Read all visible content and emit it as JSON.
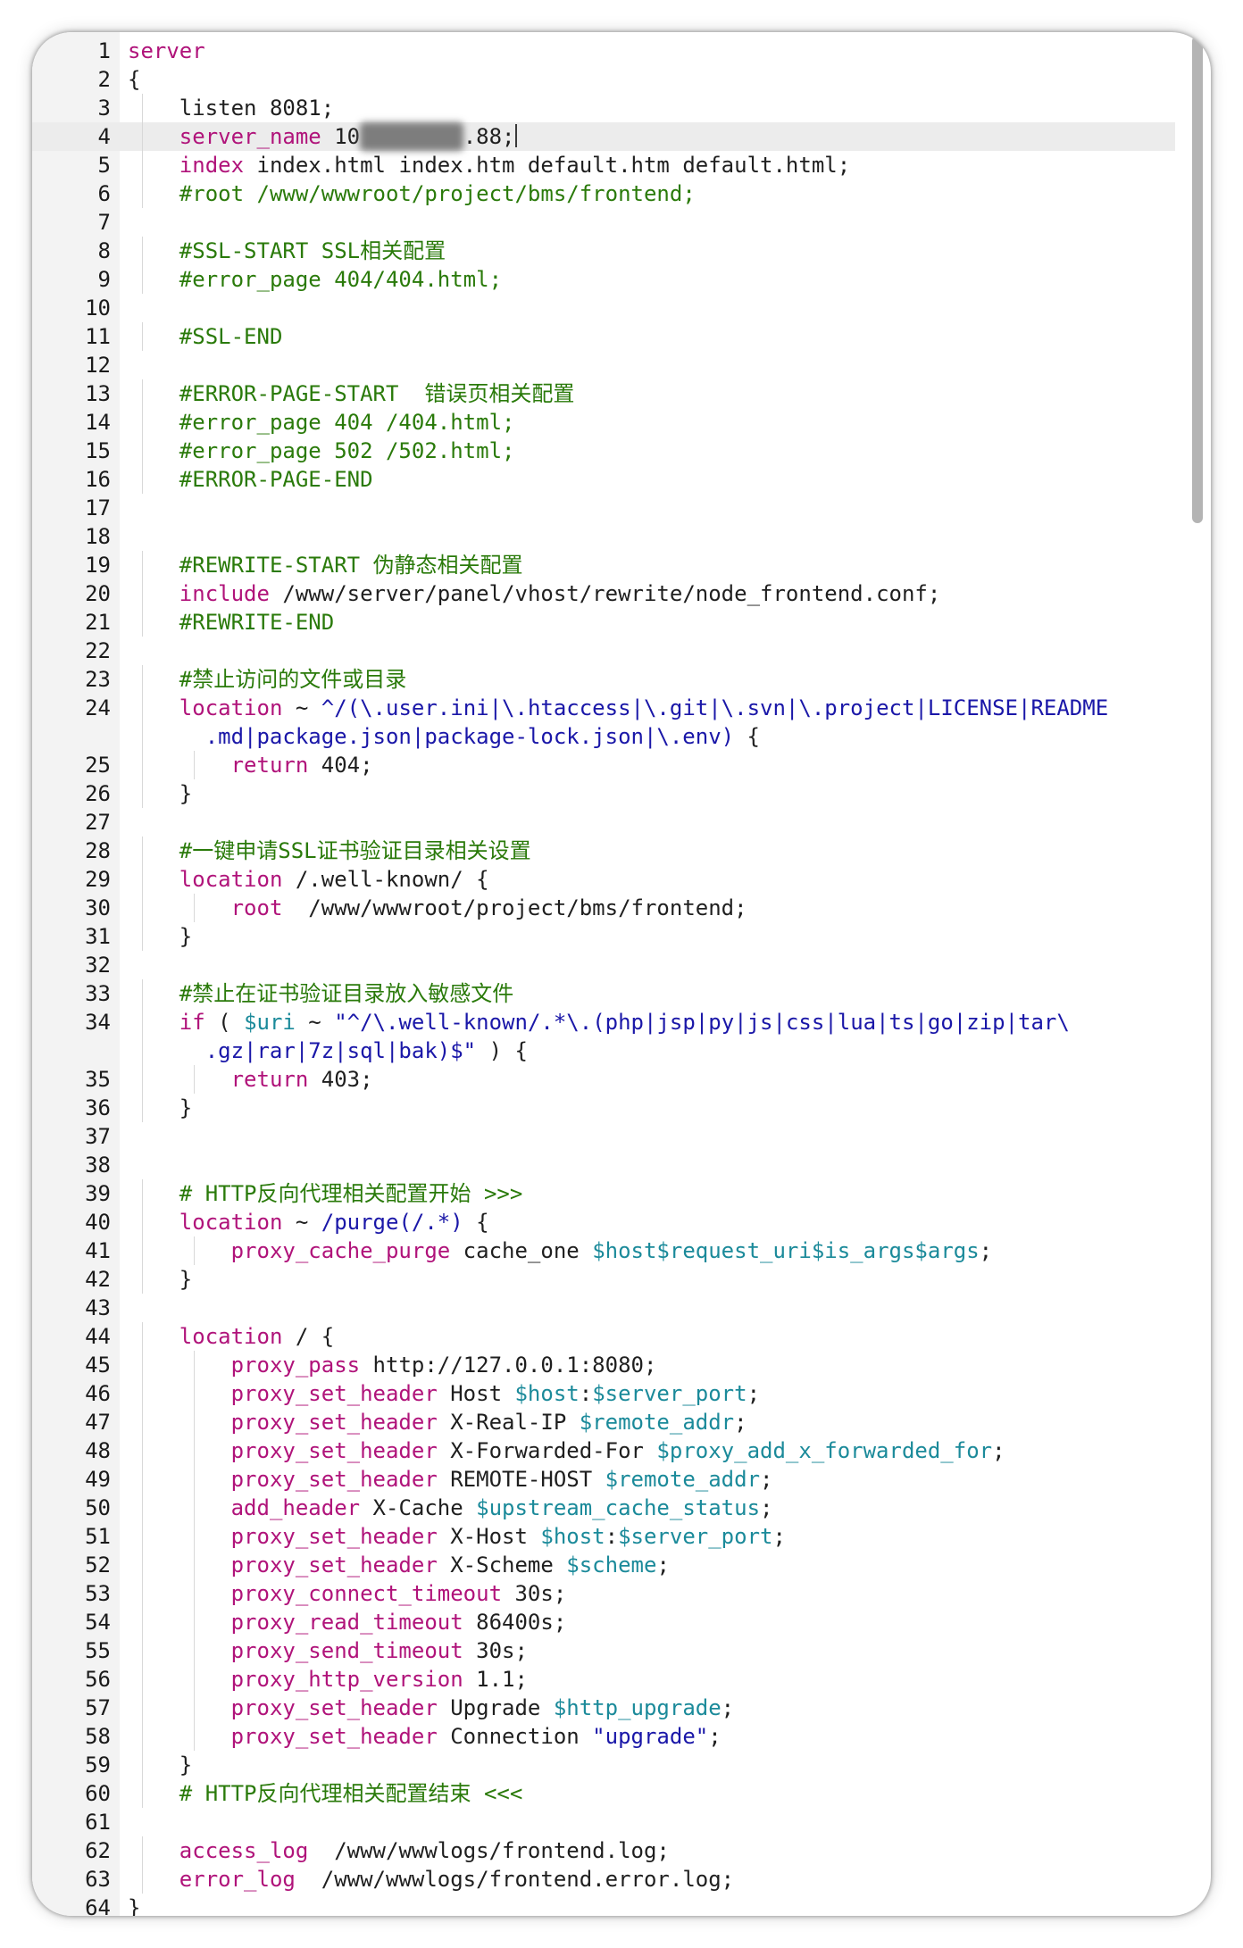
{
  "editor": {
    "active_line": 4,
    "lines": [
      {
        "n": "1",
        "indent": 0,
        "segs": [
          [
            "kw",
            "server"
          ]
        ]
      },
      {
        "n": "2",
        "indent": 0,
        "segs": [
          [
            "t",
            "{"
          ]
        ]
      },
      {
        "n": "3",
        "indent": 1,
        "segs": [
          [
            "t",
            "listen 8081;"
          ]
        ]
      },
      {
        "n": "4",
        "indent": 1,
        "segs": [
          [
            "kw",
            "server_name"
          ],
          [
            "t",
            " 10"
          ],
          [
            "blur",
            "6.1x.113"
          ],
          [
            "t",
            ".88;"
          ],
          [
            "caret",
            ""
          ]
        ]
      },
      {
        "n": "5",
        "indent": 1,
        "segs": [
          [
            "kw",
            "index"
          ],
          [
            "t",
            " index.html index.htm default.htm default.html;"
          ]
        ]
      },
      {
        "n": "6",
        "indent": 1,
        "segs": [
          [
            "cm",
            "#root /www/wwwroot/project/bms/frontend;"
          ]
        ]
      },
      {
        "n": "7",
        "indent": 0,
        "segs": []
      },
      {
        "n": "8",
        "indent": 1,
        "segs": [
          [
            "cm",
            "#SSL-START SSL相关配置"
          ]
        ]
      },
      {
        "n": "9",
        "indent": 1,
        "segs": [
          [
            "cm",
            "#error_page 404/404.html;"
          ]
        ]
      },
      {
        "n": "10",
        "indent": 0,
        "segs": []
      },
      {
        "n": "11",
        "indent": 1,
        "segs": [
          [
            "cm",
            "#SSL-END"
          ]
        ]
      },
      {
        "n": "12",
        "indent": 0,
        "segs": []
      },
      {
        "n": "13",
        "indent": 1,
        "segs": [
          [
            "cm",
            "#ERROR-PAGE-START  错误页相关配置"
          ]
        ]
      },
      {
        "n": "14",
        "indent": 1,
        "segs": [
          [
            "cm",
            "#error_page 404 /404.html;"
          ]
        ]
      },
      {
        "n": "15",
        "indent": 1,
        "segs": [
          [
            "cm",
            "#error_page 502 /502.html;"
          ]
        ]
      },
      {
        "n": "16",
        "indent": 1,
        "segs": [
          [
            "cm",
            "#ERROR-PAGE-END"
          ]
        ]
      },
      {
        "n": "17",
        "indent": 0,
        "segs": []
      },
      {
        "n": "18",
        "indent": 0,
        "segs": []
      },
      {
        "n": "19",
        "indent": 1,
        "segs": [
          [
            "cm",
            "#REWRITE-START 伪静态相关配置"
          ]
        ]
      },
      {
        "n": "20",
        "indent": 1,
        "segs": [
          [
            "kw",
            "include"
          ],
          [
            "t",
            " /www/server/panel/vhost/rewrite/node_frontend.conf;"
          ]
        ]
      },
      {
        "n": "21",
        "indent": 1,
        "segs": [
          [
            "cm",
            "#REWRITE-END"
          ]
        ]
      },
      {
        "n": "22",
        "indent": 0,
        "segs": []
      },
      {
        "n": "23",
        "indent": 1,
        "segs": [
          [
            "cm",
            "#禁止访问的文件或目录"
          ]
        ]
      },
      {
        "n": "24",
        "indent": 1,
        "segs": [
          [
            "kw",
            "location"
          ],
          [
            "t",
            " ~ "
          ],
          [
            "re",
            "^/(\\.user.ini|\\.htaccess|\\.git|\\.svn|\\.project|LICENSE|README"
          ]
        ],
        "cont": [
          [
            "re",
            ".md|package.json|package-lock.json|\\.env)"
          ],
          [
            "t",
            " {"
          ]
        ]
      },
      {
        "n": "25",
        "indent": 2,
        "segs": [
          [
            "kw",
            "return"
          ],
          [
            "t",
            " 404;"
          ]
        ]
      },
      {
        "n": "26",
        "indent": 1,
        "segs": [
          [
            "t",
            "}"
          ]
        ]
      },
      {
        "n": "27",
        "indent": 0,
        "segs": []
      },
      {
        "n": "28",
        "indent": 1,
        "segs": [
          [
            "cm",
            "#一键申请SSL证书验证目录相关设置"
          ]
        ]
      },
      {
        "n": "29",
        "indent": 1,
        "segs": [
          [
            "kw",
            "location"
          ],
          [
            "t",
            " /.well-known/ {"
          ]
        ]
      },
      {
        "n": "30",
        "indent": 2,
        "segs": [
          [
            "kw",
            "root"
          ],
          [
            "t",
            "  /www/wwwroot/project/bms/frontend;"
          ]
        ]
      },
      {
        "n": "31",
        "indent": 1,
        "segs": [
          [
            "t",
            "}"
          ]
        ]
      },
      {
        "n": "32",
        "indent": 0,
        "segs": []
      },
      {
        "n": "33",
        "indent": 1,
        "segs": [
          [
            "cm",
            "#禁止在证书验证目录放入敏感文件"
          ]
        ]
      },
      {
        "n": "34",
        "indent": 1,
        "segs": [
          [
            "kw",
            "if"
          ],
          [
            "t",
            " ( "
          ],
          [
            "var",
            "$uri"
          ],
          [
            "t",
            " ~ "
          ],
          [
            "str",
            "\"^/\\.well-known/.*\\.(php|jsp|py|js|css|lua|ts|go|zip|tar\\"
          ]
        ],
        "cont": [
          [
            "str",
            ".gz|rar|7z|sql|bak)$\""
          ],
          [
            "t",
            " ) {"
          ]
        ]
      },
      {
        "n": "35",
        "indent": 2,
        "segs": [
          [
            "kw",
            "return"
          ],
          [
            "t",
            " 403;"
          ]
        ]
      },
      {
        "n": "36",
        "indent": 1,
        "segs": [
          [
            "t",
            "}"
          ]
        ]
      },
      {
        "n": "37",
        "indent": 0,
        "segs": []
      },
      {
        "n": "38",
        "indent": 0,
        "segs": []
      },
      {
        "n": "39",
        "indent": 1,
        "segs": [
          [
            "cm",
            "# HTTP反向代理相关配置开始 >>>"
          ]
        ]
      },
      {
        "n": "40",
        "indent": 1,
        "segs": [
          [
            "kw",
            "location"
          ],
          [
            "t",
            " ~ "
          ],
          [
            "re",
            "/purge(/.*)"
          ],
          [
            "t",
            " {"
          ]
        ]
      },
      {
        "n": "41",
        "indent": 2,
        "segs": [
          [
            "kw",
            "proxy_cache_purge"
          ],
          [
            "t",
            " cache_one "
          ],
          [
            "var",
            "$host$request_uri$is_args$args"
          ],
          [
            "t",
            ";"
          ]
        ]
      },
      {
        "n": "42",
        "indent": 1,
        "segs": [
          [
            "t",
            "}"
          ]
        ]
      },
      {
        "n": "43",
        "indent": 0,
        "segs": []
      },
      {
        "n": "44",
        "indent": 1,
        "segs": [
          [
            "kw",
            "location"
          ],
          [
            "t",
            " / {"
          ]
        ]
      },
      {
        "n": "45",
        "indent": 2,
        "segs": [
          [
            "kw",
            "proxy_pass"
          ],
          [
            "t",
            " http://127.0.0.1:8080;"
          ]
        ]
      },
      {
        "n": "46",
        "indent": 2,
        "segs": [
          [
            "kw",
            "proxy_set_header"
          ],
          [
            "t",
            " Host "
          ],
          [
            "var",
            "$host"
          ],
          [
            "t",
            ":"
          ],
          [
            "var",
            "$server_port"
          ],
          [
            "t",
            ";"
          ]
        ]
      },
      {
        "n": "47",
        "indent": 2,
        "segs": [
          [
            "kw",
            "proxy_set_header"
          ],
          [
            "t",
            " X-Real-IP "
          ],
          [
            "var",
            "$remote_addr"
          ],
          [
            "t",
            ";"
          ]
        ]
      },
      {
        "n": "48",
        "indent": 2,
        "segs": [
          [
            "kw",
            "proxy_set_header"
          ],
          [
            "t",
            " X-Forwarded-For "
          ],
          [
            "var",
            "$proxy_add_x_forwarded_for"
          ],
          [
            "t",
            ";"
          ]
        ]
      },
      {
        "n": "49",
        "indent": 2,
        "segs": [
          [
            "kw",
            "proxy_set_header"
          ],
          [
            "t",
            " REMOTE-HOST "
          ],
          [
            "var",
            "$remote_addr"
          ],
          [
            "t",
            ";"
          ]
        ]
      },
      {
        "n": "50",
        "indent": 2,
        "segs": [
          [
            "kw",
            "add_header"
          ],
          [
            "t",
            " X-Cache "
          ],
          [
            "var",
            "$upstream_cache_status"
          ],
          [
            "t",
            ";"
          ]
        ]
      },
      {
        "n": "51",
        "indent": 2,
        "segs": [
          [
            "kw",
            "proxy_set_header"
          ],
          [
            "t",
            " X-Host "
          ],
          [
            "var",
            "$host"
          ],
          [
            "t",
            ":"
          ],
          [
            "var",
            "$server_port"
          ],
          [
            "t",
            ";"
          ]
        ]
      },
      {
        "n": "52",
        "indent": 2,
        "segs": [
          [
            "kw",
            "proxy_set_header"
          ],
          [
            "t",
            " X-Scheme "
          ],
          [
            "var",
            "$scheme"
          ],
          [
            "t",
            ";"
          ]
        ]
      },
      {
        "n": "53",
        "indent": 2,
        "segs": [
          [
            "kw",
            "proxy_connect_timeout"
          ],
          [
            "t",
            " 30s;"
          ]
        ]
      },
      {
        "n": "54",
        "indent": 2,
        "segs": [
          [
            "kw",
            "proxy_read_timeout"
          ],
          [
            "t",
            " 86400s;"
          ]
        ]
      },
      {
        "n": "55",
        "indent": 2,
        "segs": [
          [
            "kw",
            "proxy_send_timeout"
          ],
          [
            "t",
            " 30s;"
          ]
        ]
      },
      {
        "n": "56",
        "indent": 2,
        "segs": [
          [
            "kw",
            "proxy_http_version"
          ],
          [
            "t",
            " 1.1;"
          ]
        ]
      },
      {
        "n": "57",
        "indent": 2,
        "segs": [
          [
            "kw",
            "proxy_set_header"
          ],
          [
            "t",
            " Upgrade "
          ],
          [
            "var",
            "$http_upgrade"
          ],
          [
            "t",
            ";"
          ]
        ]
      },
      {
        "n": "58",
        "indent": 2,
        "segs": [
          [
            "kw",
            "proxy_set_header"
          ],
          [
            "t",
            " Connection "
          ],
          [
            "str",
            "\"upgrade\""
          ],
          [
            "t",
            ";"
          ]
        ]
      },
      {
        "n": "59",
        "indent": 1,
        "segs": [
          [
            "t",
            "}"
          ]
        ]
      },
      {
        "n": "60",
        "indent": 1,
        "segs": [
          [
            "cm",
            "# HTTP反向代理相关配置结束 <<<"
          ]
        ]
      },
      {
        "n": "61",
        "indent": 0,
        "segs": []
      },
      {
        "n": "62",
        "indent": 1,
        "segs": [
          [
            "kw",
            "access_log"
          ],
          [
            "t",
            "  /www/wwwlogs/frontend.log;"
          ]
        ]
      },
      {
        "n": "63",
        "indent": 1,
        "segs": [
          [
            "kw",
            "error_log"
          ],
          [
            "t",
            "  /www/wwwlogs/frontend.error.log;"
          ]
        ]
      },
      {
        "n": "64",
        "indent": 0,
        "segs": [
          [
            "t",
            "}"
          ]
        ]
      }
    ]
  },
  "scrollbar": {
    "thumb_fraction": 0.26,
    "position_fraction": 0.0
  },
  "colors": {
    "keyword": "#b0137a",
    "comment": "#2a7a0a",
    "variable": "#1b8a9a",
    "string": "#1a17a8",
    "text": "#1f1f1f",
    "gutter": "#f3f3f3"
  }
}
